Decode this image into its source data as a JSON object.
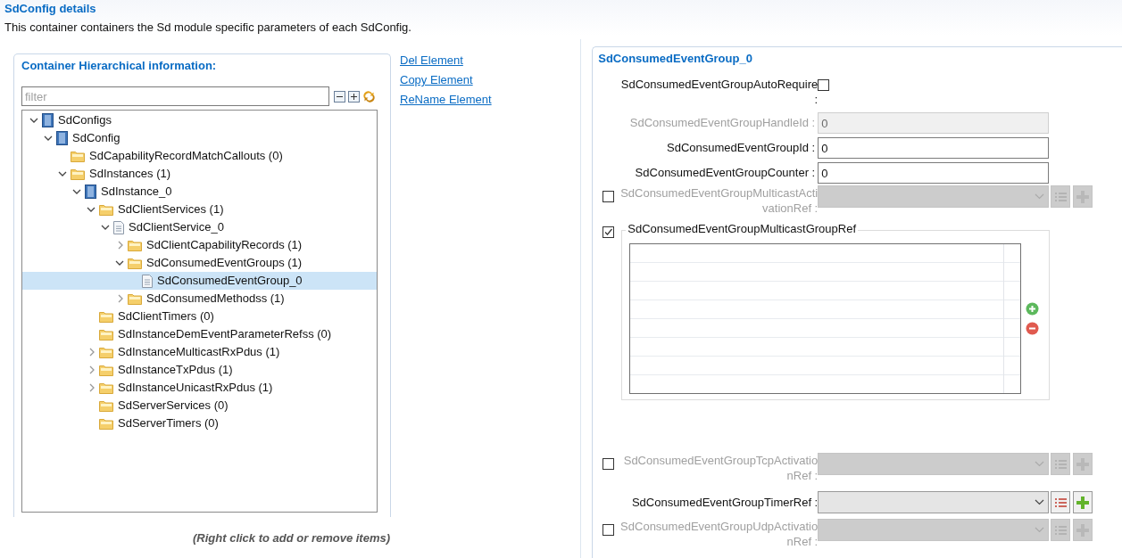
{
  "header": {
    "title": "SdConfig details",
    "description": "This container containers the Sd module specific parameters of each SdConfig."
  },
  "hierarchy": {
    "title": "Container Hierarchical information:",
    "filter_placeholder": "filter",
    "tree": [
      {
        "label": "SdConfigs",
        "kind": "module",
        "expanded": true,
        "selected": false,
        "children": [
          {
            "label": "SdConfig",
            "kind": "module",
            "expanded": true,
            "selected": false,
            "children": [
              {
                "label": "SdCapabilityRecordMatchCallouts (0)",
                "kind": "folder",
                "selected": false
              },
              {
                "label": "SdInstances (1)",
                "kind": "folder",
                "expanded": true,
                "selected": false,
                "children": [
                  {
                    "label": "SdInstance_0",
                    "kind": "module",
                    "expanded": true,
                    "selected": false,
                    "children": [
                      {
                        "label": "SdClientServices (1)",
                        "kind": "folder",
                        "expanded": true,
                        "selected": false,
                        "children": [
                          {
                            "label": "SdClientService_0",
                            "kind": "document",
                            "expanded": true,
                            "selected": false,
                            "children": [
                              {
                                "label": "SdClientCapabilityRecords (1)",
                                "kind": "folder",
                                "expanded": false,
                                "selected": false
                              },
                              {
                                "label": "SdConsumedEventGroups (1)",
                                "kind": "folder",
                                "expanded": true,
                                "selected": false,
                                "children": [
                                  {
                                    "label": "SdConsumedEventGroup_0",
                                    "kind": "document",
                                    "selected": true
                                  }
                                ]
                              },
                              {
                                "label": "SdConsumedMethodss (1)",
                                "kind": "folder",
                                "expanded": false,
                                "selected": false
                              }
                            ]
                          }
                        ]
                      },
                      {
                        "label": "SdClientTimers (0)",
                        "kind": "folder",
                        "selected": false
                      },
                      {
                        "label": "SdInstanceDemEventParameterRefss (0)",
                        "kind": "folder",
                        "selected": false
                      },
                      {
                        "label": "SdInstanceMulticastRxPdus (1)",
                        "kind": "folder",
                        "expanded": false,
                        "selected": false
                      },
                      {
                        "label": "SdInstanceTxPdus (1)",
                        "kind": "folder",
                        "expanded": false,
                        "selected": false
                      },
                      {
                        "label": "SdInstanceUnicastRxPdus (1)",
                        "kind": "folder",
                        "expanded": false,
                        "selected": false
                      },
                      {
                        "label": "SdServerServices (0)",
                        "kind": "folder",
                        "selected": false
                      },
                      {
                        "label": "SdServerTimers (0)",
                        "kind": "folder",
                        "selected": false
                      }
                    ]
                  }
                ]
              }
            ]
          }
        ]
      }
    ],
    "hint": "(Right click to add or remove items)"
  },
  "actions": [
    "Del Element",
    "Copy Element",
    "ReName Element"
  ],
  "details": {
    "title": "SdConsumedEventGroup_0",
    "fields": [
      {
        "kind": "checkbox",
        "label": "SdConsumedEventGroupAutoRequire :",
        "checked": false
      },
      {
        "kind": "text",
        "label": "SdConsumedEventGroupHandleId :",
        "value": "0",
        "disabled": true
      },
      {
        "kind": "text",
        "label": "SdConsumedEventGroupId :",
        "value": "0",
        "disabled": false
      },
      {
        "kind": "text",
        "label": "SdConsumedEventGroupCounter :",
        "value": "0",
        "disabled": false
      },
      {
        "kind": "reference",
        "label": "SdConsumedEventGroupMulticastActivationRef :",
        "optional": true,
        "checked": false
      },
      {
        "kind": "table",
        "label": "SdConsumedEventGroupMulticastGroupRef",
        "optional": true,
        "checked": true
      },
      {
        "kind": "reference",
        "label": "SdConsumedEventGroupTcpActivationRef :",
        "optional": true,
        "checked": false
      },
      {
        "kind": "reference",
        "label": "SdConsumedEventGroupTimerRef :",
        "optional": false
      },
      {
        "kind": "reference",
        "label": "SdConsumedEventGroupUdpActivationRef :",
        "optional": true,
        "checked": false
      }
    ]
  }
}
